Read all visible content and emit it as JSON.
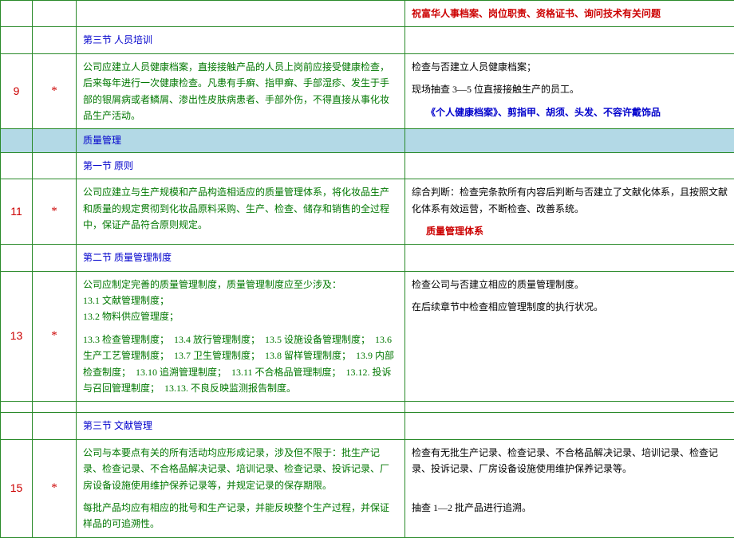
{
  "row0": {
    "col4_red": "祝富华人事档案、岗位职责、资格证书、询问技术有关问题"
  },
  "row1": {
    "title": "第三节 人员培训"
  },
  "row2": {
    "num": "9",
    "star": "*",
    "col3": "公司应建立人员健康档案，直接接触产品的人员上岗前应接受健康检查，后来每年进行一次健康检查。凡患有手癣、指甲癣、手部湿疹、发生于手部的银屑病或者鳞屑、渗出性皮肤病患者、手部外伤，不得直接从事化妆品生产活动。",
    "col4_line1": "检查与否建立人员健康档案；",
    "col4_line2": "现场抽查 3—5 位直接接触生产的员工。",
    "col4_blue": "《个人健康档案》、剪指甲、胡须、头发、不容许戴饰品"
  },
  "row3": {
    "title": "质量管理"
  },
  "row4": {
    "title": "第一节 原则"
  },
  "row5": {
    "num": "11",
    "star": "*",
    "col3": "公司应建立与生产规模和产品构造相适应的质量管理体系，将化妆品生产和质量的规定贯彻到化妆品原料采购、生产、检查、储存和销售的全过程中，保证产品符合原则规定。",
    "col4_line1": "综合判断：检查完条款所有内容后判断与否建立了文献化体系，且按照文献化体系有效运营，不断检查、改善系统。",
    "col4_red": "质量管理体系"
  },
  "row6": {
    "title": "第二节 质量管理制度"
  },
  "row7": {
    "num": "13",
    "star": "*",
    "col3_line1": "公司应制定完善的质量管理制度，质量管理制度应至少涉及：",
    "col3_line2": "13.1 文献管理制度；",
    "col3_line3": "13.2 物料供应管理度；",
    "col3_line4": "13.3 检查管理制度；　13.4 放行管理制度；　13.5 设施设备管理制度；　13.6 生产工艺管理制度；　13.7 卫生管理制度；　13.8 留样管理制度；　13.9 内部检查制度；　13.10 追溯管理制度；　13.11 不合格品管理制度；　13.12. 投诉与召回管理制度；　13.13. 不良反映监测报告制度。",
    "col4_line1": "检查公司与否建立相应的质量管理制度。",
    "col4_line2": "在后续章节中检查相应管理制度的执行状况。"
  },
  "row8": {
    "title": "第三节 文献管理"
  },
  "row9": {
    "num": "15",
    "star": "*",
    "col3_p1": "公司与本要点有关的所有活动均应形成记录，涉及但不限于：批生产记录、检查记录、不合格品解决记录、培训记录、检查记录、投诉记录、厂房设备设施使用维护保养记录等，并规定记录的保存期限。",
    "col3_p2": "每批产品均应有相应的批号和生产记录，并能反映整个生产过程，并保证样品的可追溯性。",
    "col4_p1": "检查有无批生产记录、检查记录、不合格品解决记录、培训记录、检查记录、投诉记录、厂房设备设施使用维护保养记录等。",
    "col4_p2": "抽查 1—2 批产品进行追溯。"
  }
}
